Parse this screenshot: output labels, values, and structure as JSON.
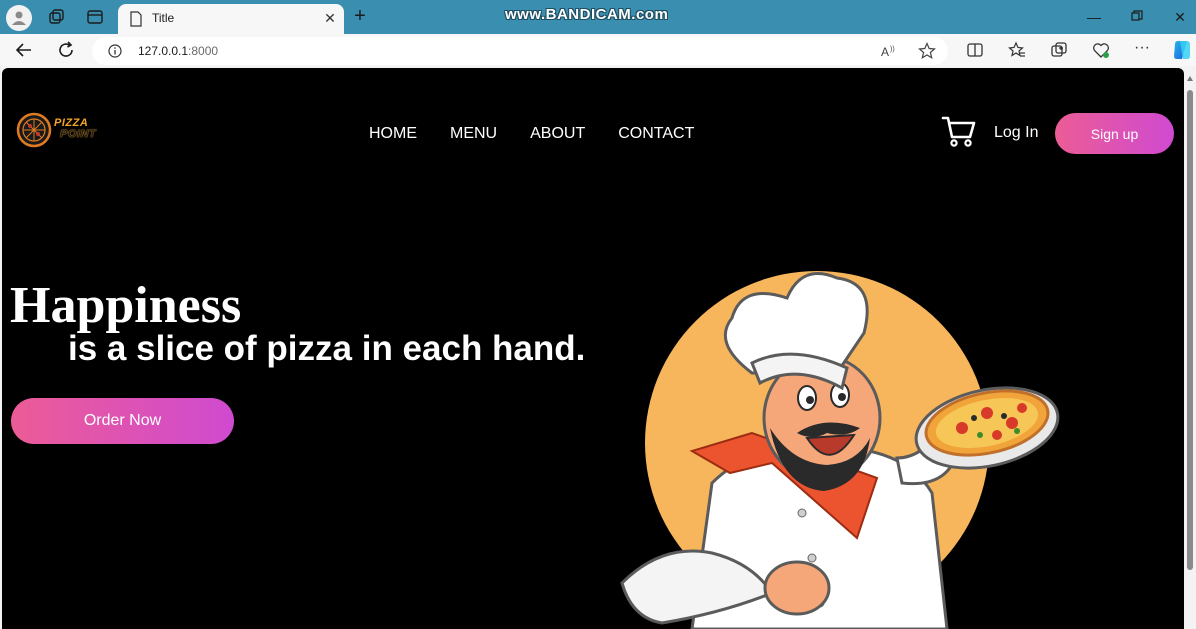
{
  "browser": {
    "tab_title": "Title",
    "watermark": "www.BANDICAM.com",
    "url_host": "127.0.0.1",
    "url_port": ":8000"
  },
  "site": {
    "logo_line1": "PIZZA",
    "logo_line2": "POINT",
    "nav": [
      "HOME",
      "MENU",
      "ABOUT",
      "CONTACT"
    ],
    "login_label": "Log In",
    "signup_label": "Sign up"
  },
  "hero": {
    "title": "Happiness",
    "subtitle": "is a slice of pizza in each hand.",
    "order_label": "Order Now"
  },
  "colors": {
    "accent_gradient_start": "#ec5c96",
    "accent_gradient_end": "#cf4ad0",
    "page_background": "#000000",
    "titlebar": "#3a8fb0"
  }
}
